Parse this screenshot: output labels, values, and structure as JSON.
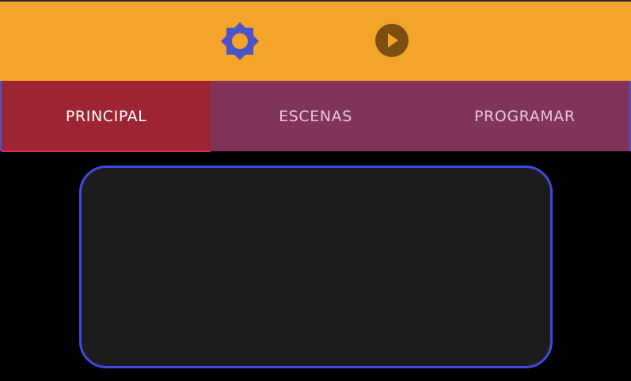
{
  "toolbar": {
    "background_color": "#f5a42a",
    "icons": [
      {
        "name": "brightness-icon",
        "color": "#4b55c8"
      },
      {
        "name": "play-circle-icon",
        "color": "#7a4f10"
      }
    ]
  },
  "tabs": {
    "active_index": 0,
    "items": [
      {
        "label": "PRINCIPAL"
      },
      {
        "label": "ESCENAS"
      },
      {
        "label": "PROGRAMAR"
      }
    ],
    "background_color": "#82335a",
    "active_color": "#9c2433"
  },
  "content": {
    "card_border_color": "#3d4be0"
  }
}
